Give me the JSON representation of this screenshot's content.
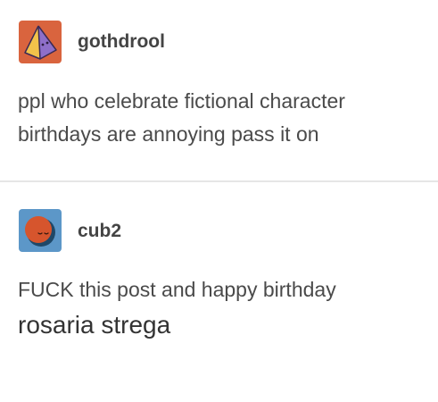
{
  "posts": [
    {
      "username": "gothdrool",
      "avatar_icon": "pyramid-face-icon",
      "avatar_bg": "#d9643e",
      "body_lines": [
        "ppl who celebrate fictional character",
        "birthdays are annoying pass it on"
      ]
    },
    {
      "username": "cub2",
      "avatar_icon": "sleepy-circle-face-icon",
      "avatar_bg": "#5c97c8",
      "body_lines": [
        "FUCK this post and happy birthday",
        "rosaria strega"
      ]
    }
  ],
  "colors": {
    "text": "#4a4a4a",
    "divider": "#e6e6e6",
    "background": "#ffffff"
  }
}
